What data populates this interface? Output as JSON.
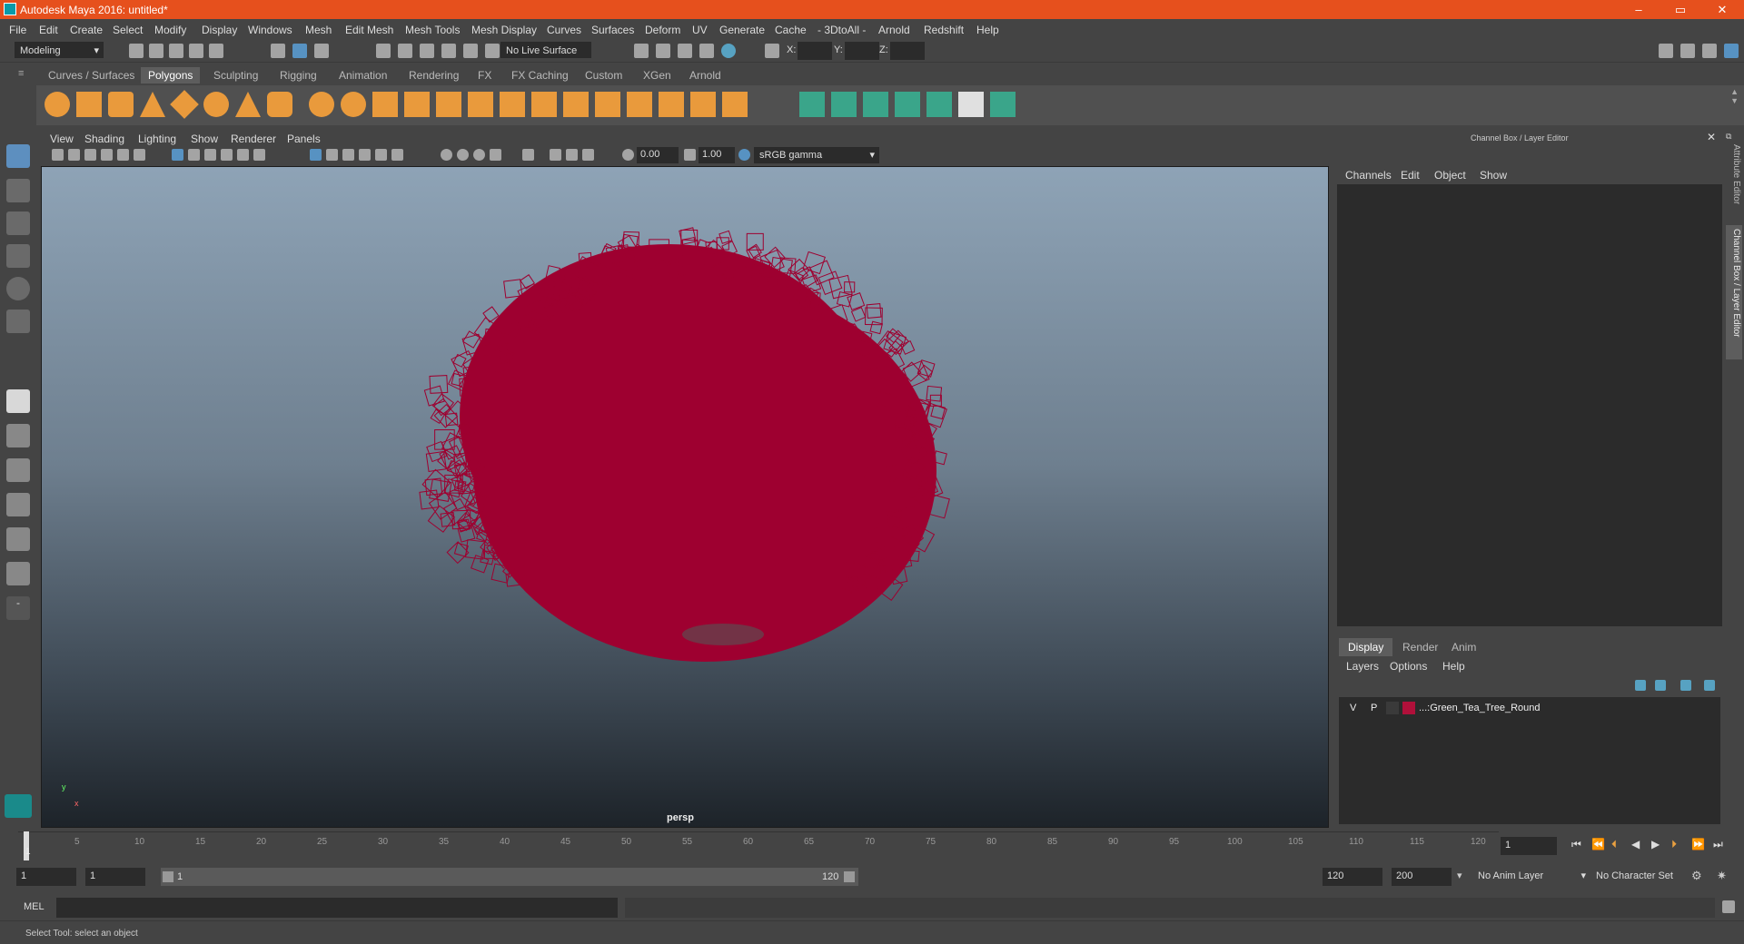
{
  "window": {
    "title": "Autodesk Maya 2016: untitled*",
    "controls": [
      "–",
      "▭",
      "✕"
    ]
  },
  "menubar": [
    "File",
    "Edit",
    "Create",
    "Select",
    "Modify",
    "Display",
    "Windows",
    "Mesh",
    "Edit Mesh",
    "Mesh Tools",
    "Mesh Display",
    "Curves",
    "Surfaces",
    "Deform",
    "UV",
    "Generate",
    "Cache",
    "- 3DtoAll -",
    "Arnold",
    "Redshift",
    "Help"
  ],
  "statusline": {
    "mode": "Modeling",
    "live_surface": "No Live Surface",
    "x_label": "X:",
    "y_label": "Y:",
    "z_label": "Z:"
  },
  "shelf_tabs": [
    "Curves / Surfaces",
    "Polygons",
    "Sculpting",
    "Rigging",
    "Animation",
    "Rendering",
    "FX",
    "FX Caching",
    "Custom",
    "XGen",
    "Arnold"
  ],
  "shelf_active": "Polygons",
  "panel": {
    "menu": [
      "View",
      "Shading",
      "Lighting",
      "Show",
      "Renderer",
      "Panels"
    ],
    "exposure": "0.00",
    "gamma": "1.00",
    "colorspace": "sRGB gamma",
    "camera_label": "persp",
    "axis_y": "y",
    "axis_x": "x",
    "mesh_color": "#9e0030"
  },
  "channelbox": {
    "header": "Channel Box / Layer Editor",
    "menu": [
      "Channels",
      "Edit",
      "Object",
      "Show"
    ]
  },
  "layereditor": {
    "tabs": [
      "Display",
      "Render",
      "Anim"
    ],
    "active_tab": "Display",
    "menu": [
      "Layers",
      "Options",
      "Help"
    ],
    "layer": {
      "v": "V",
      "p": "P",
      "color": "#b0103a",
      "name": "...:Green_Tea_Tree_Round"
    }
  },
  "side_tabs": [
    "Attribute Editor",
    "Channel Box / Layer Editor"
  ],
  "timeline": {
    "ticks": [
      "1",
      "5",
      "10",
      "15",
      "20",
      "25",
      "30",
      "35",
      "40",
      "45",
      "50",
      "55",
      "60",
      "65",
      "70",
      "75",
      "80",
      "85",
      "90",
      "95",
      "100",
      "105",
      "110",
      "115",
      "120"
    ],
    "current_frame": "1"
  },
  "range": {
    "start": "1",
    "anim_start": "1",
    "slider_start": "1",
    "slider_end": "120",
    "end": "120",
    "anim_end": "200",
    "anim_layer": "No Anim Layer",
    "char_set": "No Character Set"
  },
  "mel": {
    "label": "MEL"
  },
  "help_line": "Select Tool: select an object"
}
